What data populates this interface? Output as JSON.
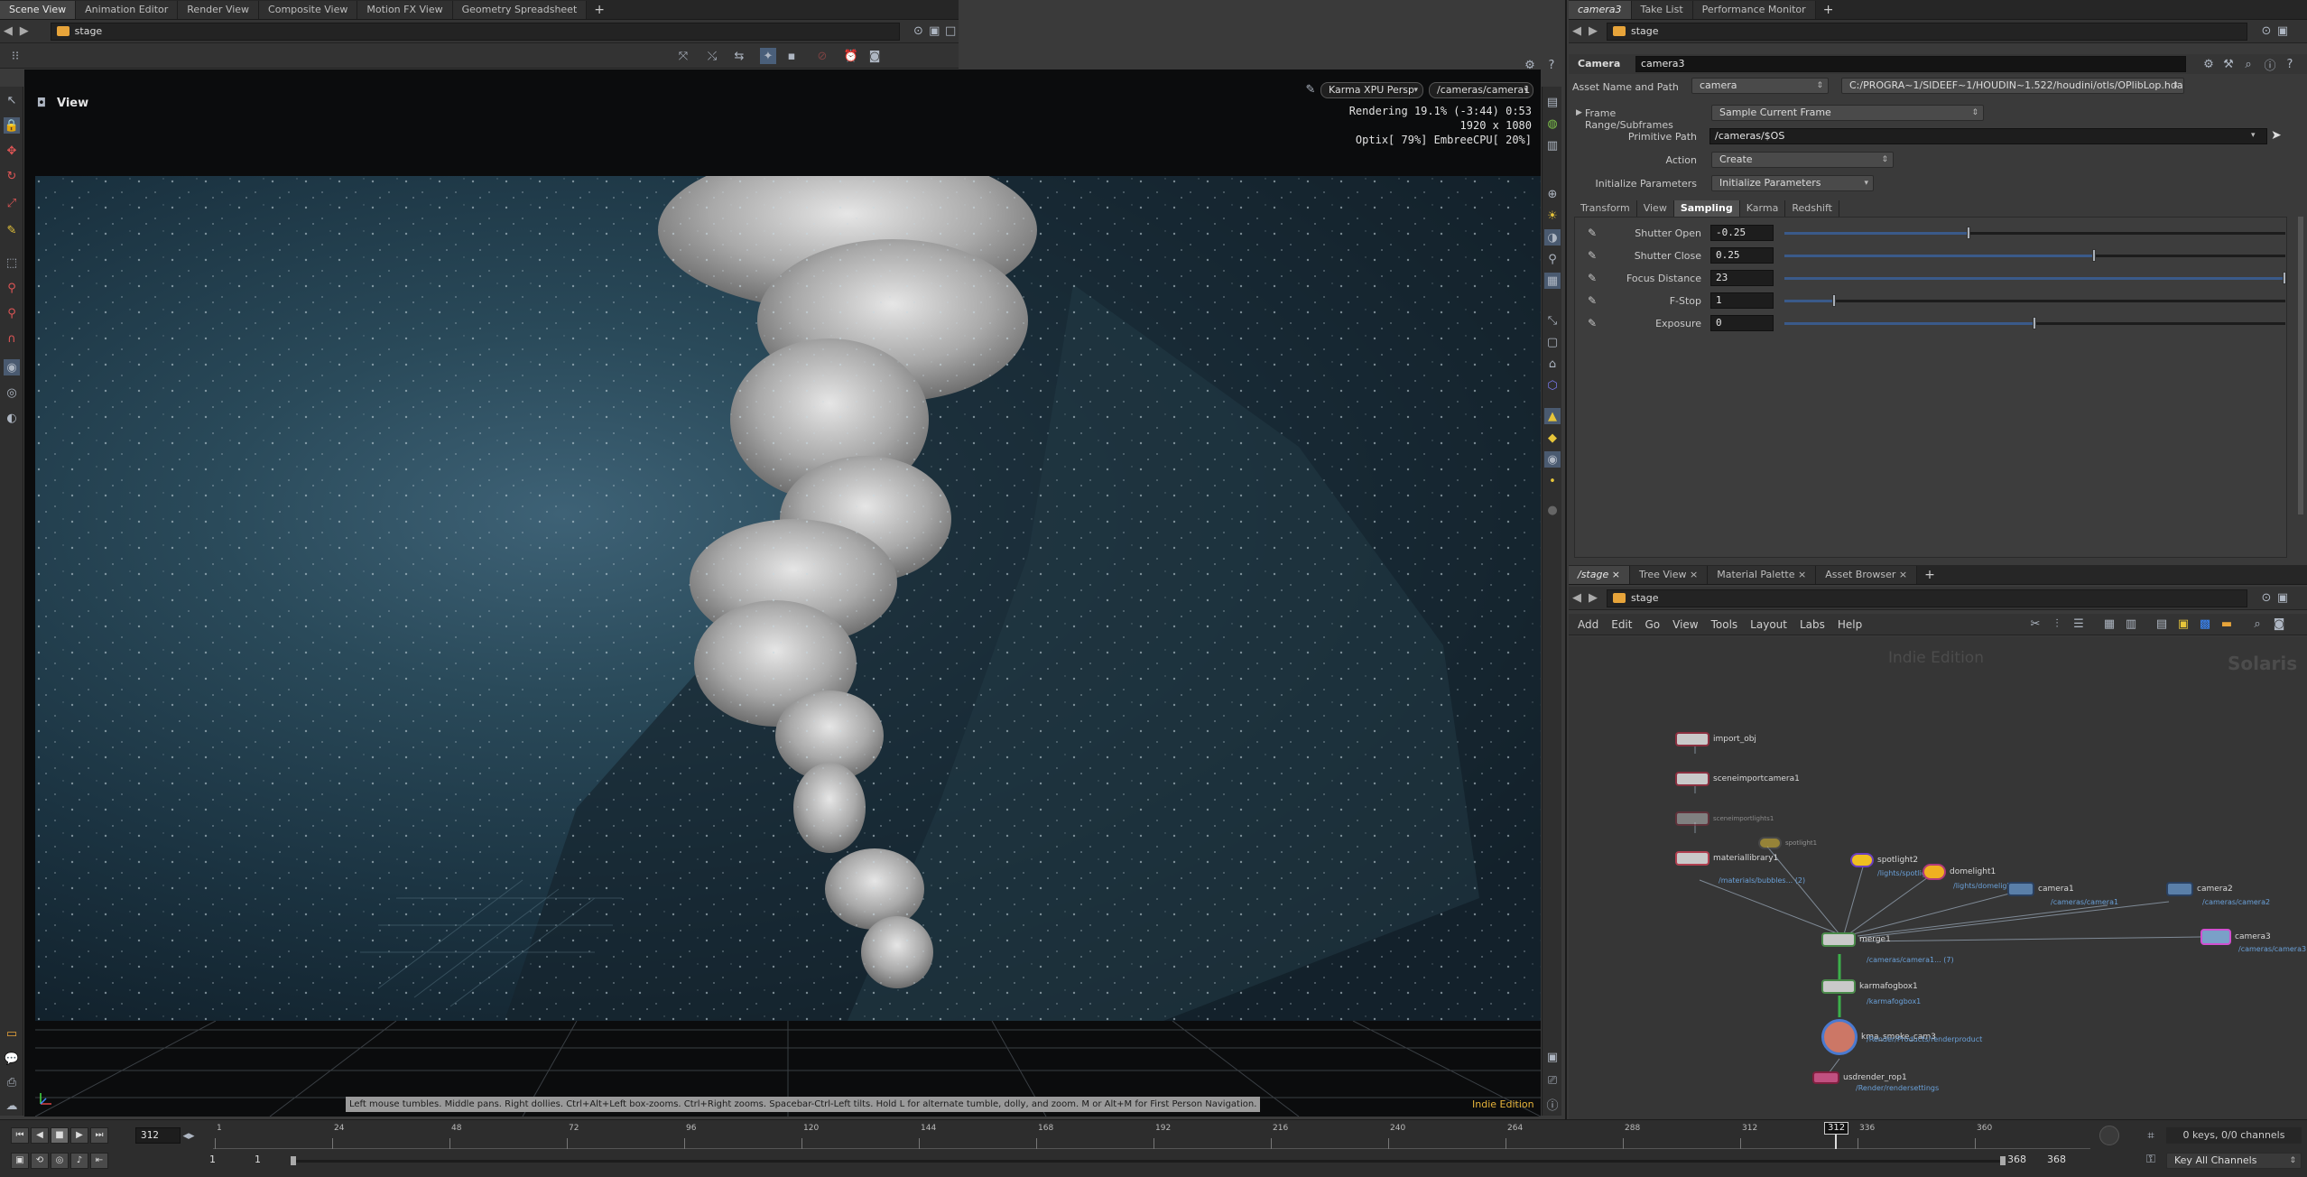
{
  "left_tabs": [
    "Scene View",
    "Animation Editor",
    "Render View",
    "Composite View",
    "Motion FX View",
    "Geometry Spreadsheet"
  ],
  "right_tabs": [
    "camera3",
    "Take List",
    "Performance Monitor"
  ],
  "left_path": "stage",
  "right_path": "stage",
  "viewport": {
    "title": "View",
    "renderer": "Karma XPU  Persp",
    "camera": "/cameras/camera1",
    "stats_line1": "Rendering  19.1%  (-3:44)  0:53",
    "stats_line2": "1920 x 1080",
    "stats_line3": "Optix[ 79%] EmbreeCPU[ 20%]",
    "hint": "Left mouse tumbles. Middle pans. Right dollies. Ctrl+Alt+Left box-zooms. Ctrl+Right zooms. Spacebar-Ctrl-Left tilts. Hold L for alternate tumble, dolly, and zoom. M or Alt+M for First Person Navigation.",
    "edition": "Indie Edition"
  },
  "params": {
    "node_type": "Camera",
    "node_name": "camera3",
    "asset_label": "Asset Name and Path",
    "asset_value": "camera",
    "asset_path": "C:/PROGRA~1/SIDEEF~1/HOUDIN~1.522/houdini/otls/OPlibLop.hda",
    "frame_range_label": "Frame Range/Subframes",
    "frame_range_value": "Sample Current Frame",
    "prim_path_label": "Primitive Path",
    "prim_path_value": "/cameras/$OS",
    "action_label": "Action",
    "action_value": "Create",
    "init_label": "Initialize Parameters",
    "init_value": "Initialize Parameters",
    "subtabs": [
      "Transform",
      "View",
      "Sampling",
      "Karma",
      "Redshift"
    ],
    "rows": [
      {
        "label": "Shutter Open",
        "value": "-0.25",
        "fraction": 0.37
      },
      {
        "label": "Shutter Close",
        "value": "0.25",
        "fraction": 0.62
      },
      {
        "label": "Focus Distance",
        "value": "23",
        "fraction": 1.0
      },
      {
        "label": "F-Stop",
        "value": "1",
        "fraction": 0.1
      },
      {
        "label": "Exposure",
        "value": "0",
        "fraction": 0.5
      }
    ]
  },
  "network": {
    "tabs": [
      "/stage",
      "Tree View",
      "Material Palette",
      "Asset Browser"
    ],
    "menus": [
      "Add",
      "Edit",
      "Go",
      "View",
      "Tools",
      "Layout",
      "Labs",
      "Help"
    ],
    "watermark_left": "Indie Edition",
    "watermark_right": "Solaris",
    "nodes": [
      {
        "name": "import_obj",
        "sub": ""
      },
      {
        "name": "sceneimportcamera1",
        "sub": ""
      },
      {
        "name": "sceneimportlights1",
        "sub": ""
      },
      {
        "name": "materiallibrary1",
        "sub": "/materials/bubbles... (2)"
      },
      {
        "name": "spotlight1",
        "sub": ""
      },
      {
        "name": "spotlight2",
        "sub": "/lights/spotlight2"
      },
      {
        "name": "domelight1",
        "sub": "/lights/domelight1"
      },
      {
        "name": "camera1",
        "sub": "/cameras/camera1"
      },
      {
        "name": "camera2",
        "sub": "/cameras/camera2"
      },
      {
        "name": "camera3",
        "sub": "/cameras/camera3"
      },
      {
        "name": "merge1",
        "sub": "/cameras/camera1... (7)"
      },
      {
        "name": "karmafogbox1",
        "sub": "/karmafogbox1"
      },
      {
        "name": "kma_smoke_cam3",
        "sub": "/Render/Products/renderproduct"
      },
      {
        "name": "usdrender_rop1",
        "sub": "/Render/rendersettings"
      }
    ]
  },
  "timeline": {
    "ticks": [
      "1",
      "24",
      "48",
      "72",
      "96",
      "120",
      "144",
      "168",
      "192",
      "216",
      "240",
      "264",
      "288",
      "312",
      "336",
      "360"
    ],
    "current_frame": "312",
    "start_a": "1",
    "start_b": "1",
    "end_a": "368",
    "end_b": "368",
    "keys_info": "0 keys, 0/0 channels",
    "key_all": "Key All Channels",
    "playhead_fraction": 0.864
  }
}
